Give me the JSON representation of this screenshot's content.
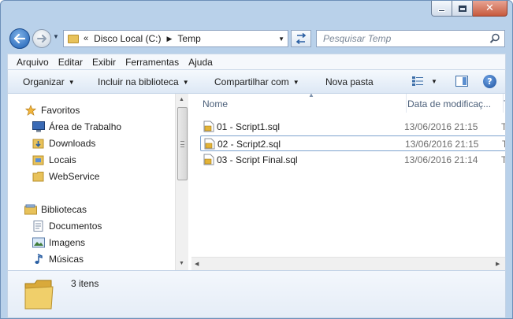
{
  "window": {
    "caption": {
      "minimize": "minimize",
      "maximize": "maximize",
      "close": "close"
    }
  },
  "nav": {
    "breadcrumb": {
      "overflow": "«",
      "segments": [
        "Disco Local (C:)",
        "Temp"
      ]
    },
    "search": {
      "placeholder": "Pesquisar Temp"
    }
  },
  "menubar": {
    "items": [
      "Arquivo",
      "Editar",
      "Exibir",
      "Ferramentas",
      "Ajuda"
    ]
  },
  "commandbar": {
    "organize": "Organizar",
    "include": "Incluir na biblioteca",
    "share": "Compartilhar com",
    "new_folder": "Nova pasta"
  },
  "sidebar": {
    "favorites": {
      "label": "Favoritos",
      "items": [
        "Área de Trabalho",
        "Downloads",
        "Locais",
        "WebService"
      ]
    },
    "libraries": {
      "label": "Bibliotecas",
      "items": [
        "Documentos",
        "Imagens",
        "Músicas"
      ]
    }
  },
  "filelist": {
    "columns": {
      "name": "Nome",
      "date": "Data de modificaç...",
      "type": "T"
    },
    "rows": [
      {
        "name": "01 - Script1.sql",
        "date": "13/06/2016 21:15",
        "type": "T",
        "selected": false
      },
      {
        "name": "02 - Script2.sql",
        "date": "13/06/2016 21:15",
        "type": "T",
        "selected": true
      },
      {
        "name": "03 - Script Final.sql",
        "date": "13/06/2016 21:14",
        "type": "T",
        "selected": false
      }
    ]
  },
  "details": {
    "count": "3 itens"
  },
  "colors": {
    "accent": "#1d5fb3",
    "folder": "#e8c25a",
    "selection_border": "#7da2ce"
  }
}
